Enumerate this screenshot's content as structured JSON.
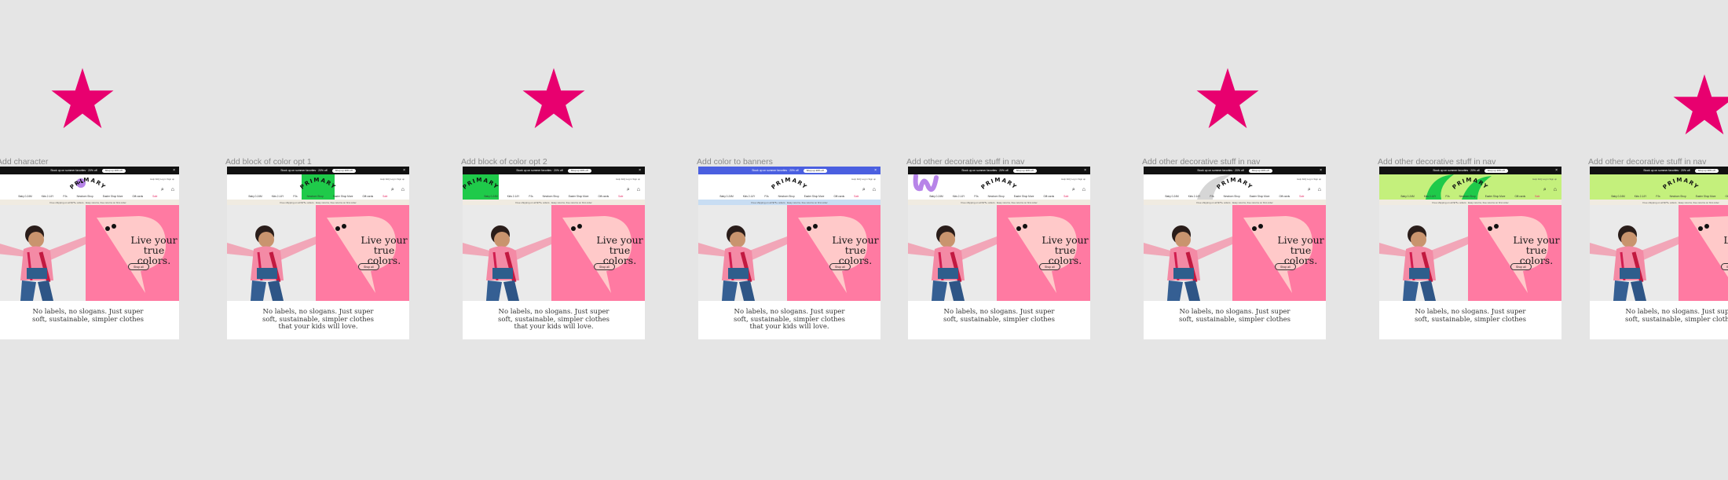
{
  "canvas_bg": "#e5e5e5",
  "accent_star": "#e8006f",
  "frames": [
    {
      "title": "Add character",
      "variant": "character",
      "tagline_line3": ""
    },
    {
      "title": "Add block of color opt 1",
      "variant": "color-block-1",
      "tagline_line3": "that your kids will love."
    },
    {
      "title": "Add block of color opt 2",
      "variant": "color-block-2",
      "tagline_line3": "that your kids will love."
    },
    {
      "title": "Add color to banners",
      "variant": "banners",
      "tagline_line3": "that your kids will love."
    },
    {
      "title": "Add other decorative stuff in nav",
      "variant": "deco-purple",
      "tagline_line3": ""
    },
    {
      "title": "Add other decorative stuff in nav",
      "variant": "deco-grey",
      "tagline_line3": ""
    },
    {
      "title": "Add other decorative stuff in nav",
      "variant": "deco-green",
      "tagline_line3": ""
    },
    {
      "title": "Add other decorative stuff in nav",
      "variant": "deco-lime",
      "tagline_line3": ""
    }
  ],
  "site": {
    "logo": "PRIMARY",
    "promo_text": "Stock up on summer favorites · 20% off",
    "promo_cta": "Shop up 20% off",
    "utility_links": "Help   FAQ   Log in   Sign up",
    "nav": [
      "Baby 0-24M",
      "Kids 2-14Y",
      "PJs",
      "Newborn Shop",
      "Easter Shop More",
      "Gift cards",
      "Sale"
    ],
    "announcement": "Free shipping on all $75+ orders · Easy returns, free returns on first order",
    "hero_headline_1": "Live your",
    "hero_headline_2": "true colors.",
    "hero_cta": "Shop all",
    "tagline_line1": "No labels, no slogans. Just super",
    "tagline_line2": "soft, sustainable, simpler clothes"
  },
  "colors": {
    "hero_pink": "#ff7aa2",
    "blob_pink": "#ffc9c9",
    "green_block": "#1fca4a",
    "banner_blue": "#4a5fe0",
    "banner_light_blue": "#c8ddf3",
    "lime": "#c4f07c",
    "purple": "#b784e8",
    "grey": "#d6d6d6"
  }
}
